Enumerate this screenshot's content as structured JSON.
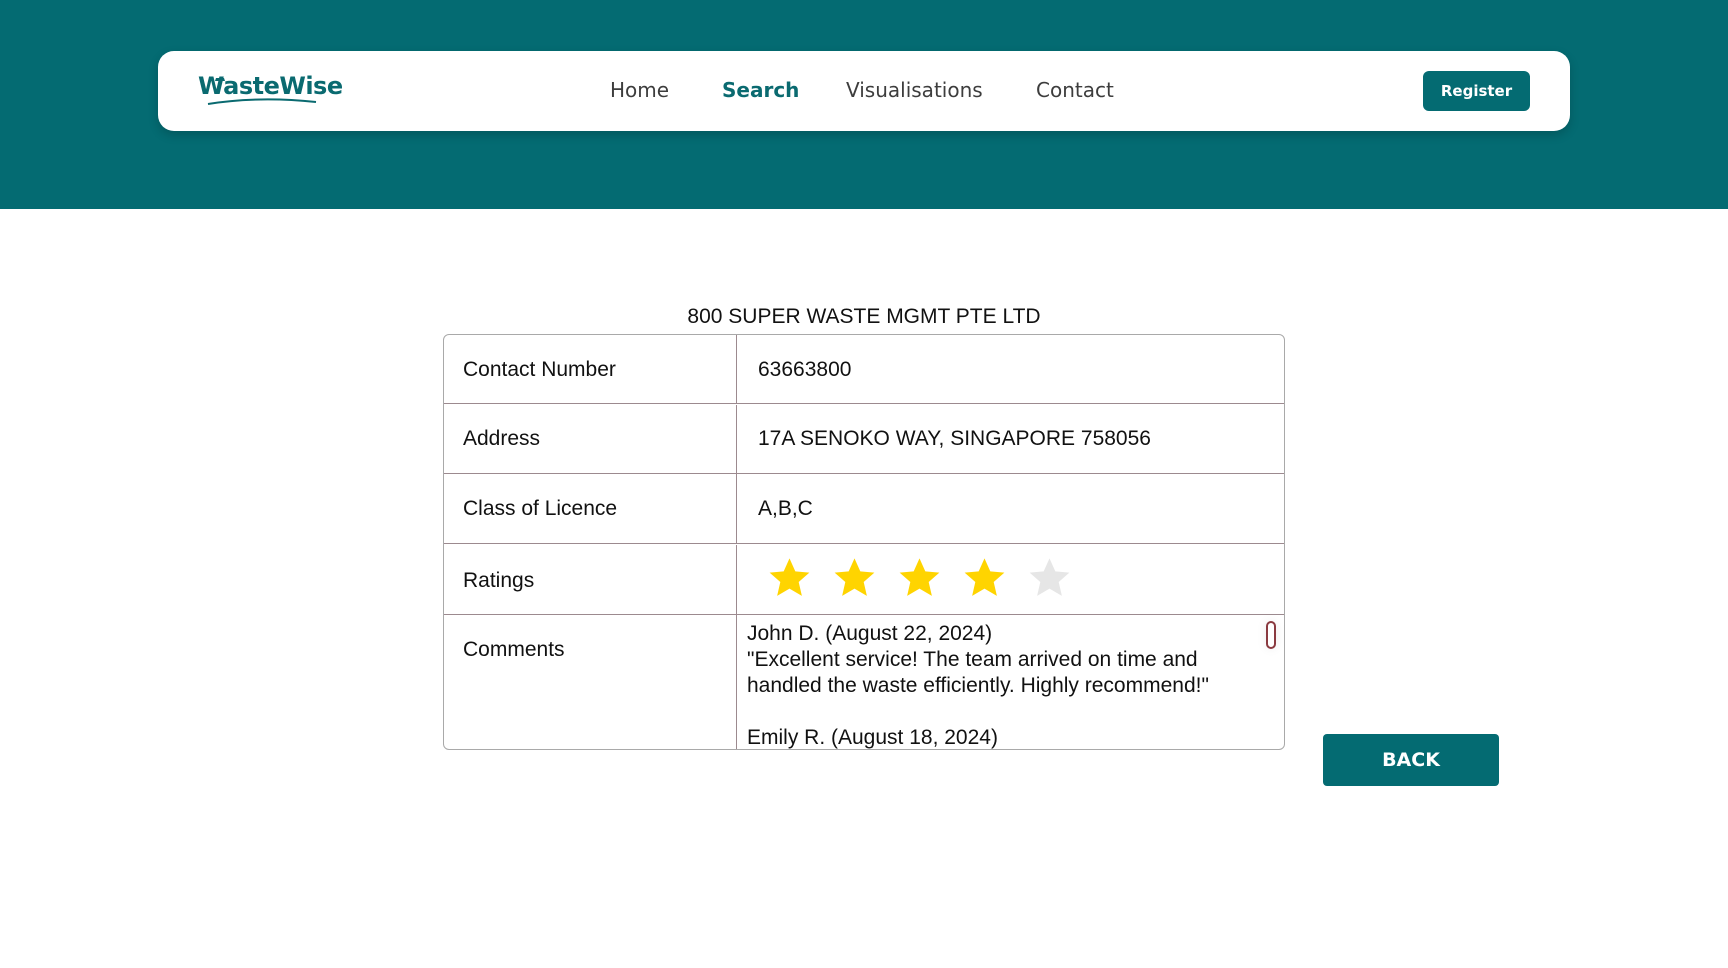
{
  "brand": {
    "logo_text": "WasteWise",
    "primary_color": "#046b72",
    "text_color_active": "#0a6a70"
  },
  "nav": {
    "links": [
      {
        "label": "Home",
        "active": false
      },
      {
        "label": "Search",
        "active": true
      },
      {
        "label": "Visualisations",
        "active": false
      },
      {
        "label": "Contact",
        "active": false
      }
    ],
    "register_label": "Register"
  },
  "company": {
    "name": "800 SUPER WASTE MGMT PTE LTD",
    "rows": {
      "contact": {
        "label": "Contact Number",
        "value": "63663800"
      },
      "address": {
        "label": "Address",
        "value": "17A SENOKO WAY, SINGAPORE 758056"
      },
      "licence": {
        "label": "Class of Licence",
        "value": "A,B,C"
      },
      "ratings": {
        "label": "Ratings",
        "value": 4,
        "max": 5,
        "filled_color": "#ffd400",
        "empty_color": "#e6e6e6"
      },
      "comments": {
        "label": "Comments"
      }
    },
    "comments": [
      {
        "author": "John D. (August 22, 2024)",
        "text": "\"Excellent service! The team arrived on time and\nhandled the waste efficiently. Highly recommend!\""
      },
      {
        "author": "Emily R. (August 18, 2024)",
        "text": ""
      }
    ]
  },
  "actions": {
    "back_label": "BACK"
  }
}
